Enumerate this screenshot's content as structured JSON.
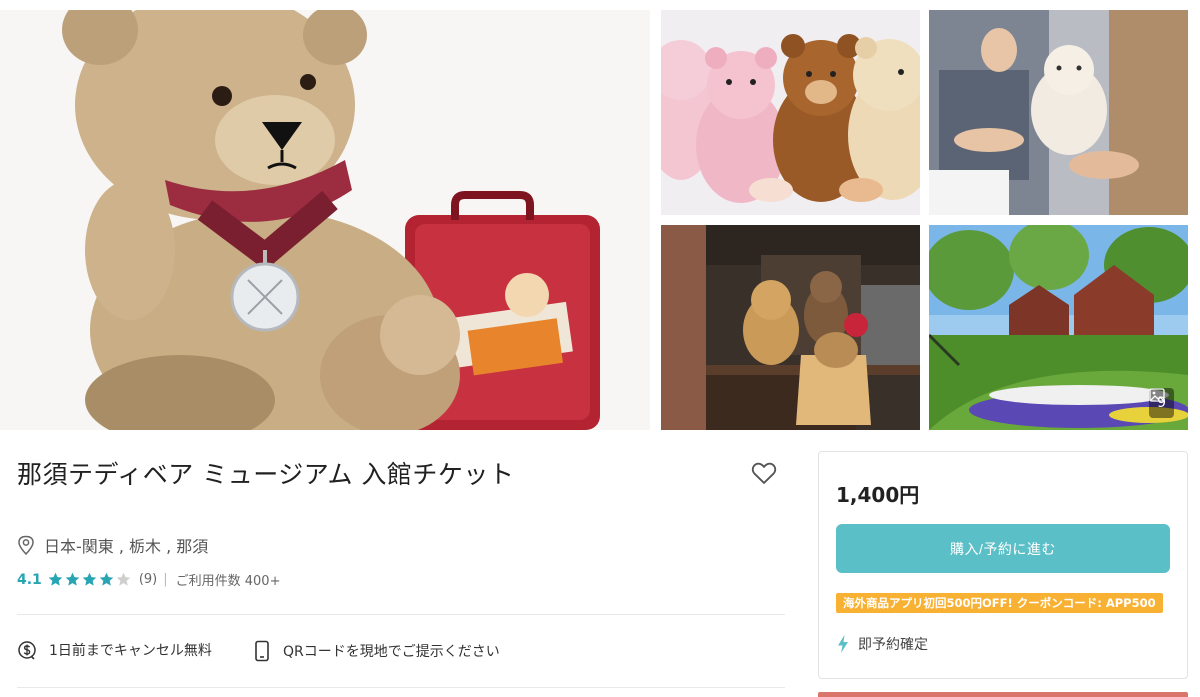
{
  "product": {
    "title": "那須テディベア ミュージアム 入館チケット",
    "location": "日本-関東 , 栃木 , 那須",
    "rating": {
      "score": "4.1",
      "stars": 4,
      "max_stars": 5,
      "count": "(9)",
      "separator": "|",
      "usage": "ご利用件数 400+"
    },
    "features": {
      "cancel": "1日前までキャンセル無料",
      "qr": "QRコードを現地でご提示ください"
    },
    "icons": {
      "wishlist": "heart-outline-icon",
      "location": "map-pin-icon",
      "cancel": "dollar-cancel-icon",
      "qr": "phone-icon",
      "photos": "image-icon",
      "instant": "lightning-icon",
      "star": "star-icon"
    }
  },
  "gallery": {
    "photo_count": "9"
  },
  "booking": {
    "price": "1,400円",
    "button_label": "購入/予約に進む",
    "promo": "海外商品アプリ初回500円OFF! クーポンコード: APP500",
    "instant_label": "即予約確定"
  },
  "colors": {
    "accent_teal": "#5bbfc7",
    "rating_teal": "#27a5b3",
    "promo_orange": "#f8b133",
    "star_gray": "#cfcfcf"
  }
}
